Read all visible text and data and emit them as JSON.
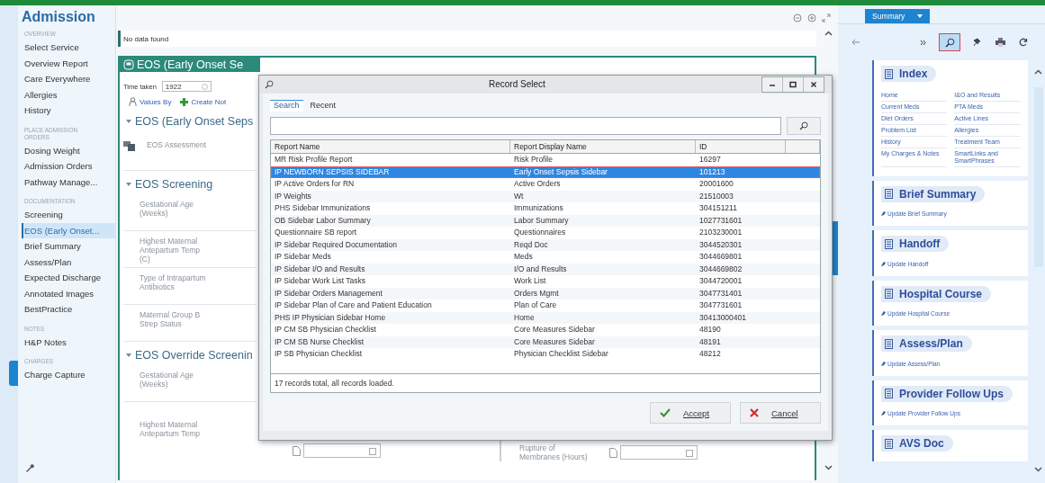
{
  "app": {
    "title": "Admission",
    "message": "No data found"
  },
  "sidebar": {
    "groups": [
      {
        "heading": "OVERVIEW",
        "items": [
          {
            "label": "Select Service",
            "selected": false
          },
          {
            "label": "Overview Report",
            "selected": false
          },
          {
            "label": "Care Everywhere",
            "selected": false
          },
          {
            "label": "Allergies",
            "selected": false
          },
          {
            "label": "History",
            "selected": false
          }
        ]
      },
      {
        "heading": "PLACE ADMISSION ORDERS",
        "items": [
          {
            "label": "Dosing Weight",
            "selected": false
          },
          {
            "label": "Admission Orders",
            "selected": false
          },
          {
            "label": "Pathway Manage...",
            "selected": false
          }
        ]
      },
      {
        "heading": "DOCUMENTATION",
        "items": [
          {
            "label": "Screening",
            "selected": false
          },
          {
            "label": "EOS (Early Onset...",
            "selected": true
          },
          {
            "label": "Brief Summary",
            "selected": false
          },
          {
            "label": "Assess/Plan",
            "selected": false
          },
          {
            "label": "Expected Discharge",
            "selected": false
          },
          {
            "label": "Annotated Images",
            "selected": false
          },
          {
            "label": "BestPractice",
            "selected": false
          }
        ]
      },
      {
        "heading": "NOTES",
        "items": [
          {
            "label": "H&P Notes",
            "selected": false
          }
        ]
      },
      {
        "heading": "CHARGES",
        "items": [
          {
            "label": "Charge Capture",
            "selected": false
          }
        ]
      }
    ]
  },
  "form": {
    "title": "EOS (Early Onset Se",
    "time_label": "Time taken",
    "time_value": "1922",
    "actions": [
      {
        "kind": "person",
        "label": "Values By"
      },
      {
        "kind": "plus",
        "label": "Create Not"
      }
    ],
    "sections": [
      {
        "title": "EOS (Early Onset Seps",
        "expanded": true,
        "rows": [
          {
            "kind": "assessment",
            "label": "EOS Assessment"
          }
        ]
      },
      {
        "title": "EOS Screening",
        "expanded": true,
        "rows": [
          {
            "kind": "text",
            "label": "Gestational Age (Weeks)"
          },
          {
            "kind": "text",
            "label": "Highest Maternal Antepartum Temp (C)"
          },
          {
            "kind": "text",
            "label": "Type of Intrapartum Antibiotics"
          },
          {
            "kind": "text",
            "label": "Maternal Group B Strep Status"
          }
        ]
      },
      {
        "title": "EOS Override Screenin",
        "expanded": true,
        "rows": [
          {
            "kind": "text",
            "label": "Gestational Age (Weeks)"
          },
          {
            "kind": "fields",
            "label": "Highest Maternal Antepartum Temp",
            "label_2": "Rupture of Membranes (Hours)"
          }
        ]
      }
    ]
  },
  "dialog": {
    "title": "Record Select",
    "tabs": [
      {
        "label": "Search",
        "selected": true
      },
      {
        "label": "Recent",
        "selected": false
      }
    ],
    "columns": [
      "Report Name",
      "Report Display Name",
      "ID"
    ],
    "rows": [
      {
        "name": "MR Risk Profile Report",
        "display": "Risk Profile",
        "id": "16297",
        "selected": false
      },
      {
        "name": "IP NEWBORN SEPSIS SIDEBAR",
        "display": "Early Onset Sepsis Sidebar",
        "id": "101213",
        "selected": true
      },
      {
        "name": "IP Active Orders for RN",
        "display": "Active Orders",
        "id": "20001600",
        "selected": false
      },
      {
        "name": "IP Weights",
        "display": "Wt",
        "id": "21510003",
        "selected": false
      },
      {
        "name": "PHS Sidebar Immunizations",
        "display": "Immunizations",
        "id": "304151211",
        "selected": false
      },
      {
        "name": "OB Sidebar Labor Summary",
        "display": "Labor Summary",
        "id": "1027731601",
        "selected": false
      },
      {
        "name": "Questionnaire SB report",
        "display": "Questionnaires",
        "id": "2103230001",
        "selected": false
      },
      {
        "name": "IP Sidebar Required Documentation",
        "display": "Reqd Doc",
        "id": "3044520301",
        "selected": false
      },
      {
        "name": "IP Sidebar Meds",
        "display": "Meds",
        "id": "3044669801",
        "selected": false
      },
      {
        "name": "IP Sidebar I/O and Results",
        "display": "I/O and Results",
        "id": "3044669802",
        "selected": false
      },
      {
        "name": "IP Sidebar Work List Tasks",
        "display": "Work List",
        "id": "3044720001",
        "selected": false
      },
      {
        "name": "IP Sidebar Orders Management",
        "display": "Orders Mgmt",
        "id": "3047731401",
        "selected": false
      },
      {
        "name": "IP Sidebar Plan of Care and Patient Education",
        "display": "Plan of Care",
        "id": "3047731601",
        "selected": false
      },
      {
        "name": "PHS IP Physician Sidebar Home",
        "display": "Home",
        "id": "30413000401",
        "selected": false
      },
      {
        "name": "IP CM SB Physician Checklist",
        "display": "Core Measures Sidebar",
        "id": "48190",
        "selected": false
      },
      {
        "name": "IP CM SB Nurse Checklist",
        "display": "Core Measures Sidebar",
        "id": "48191",
        "selected": false
      },
      {
        "name": "IP SB Physician Checklist",
        "display": "Physician Checklist Sidebar",
        "id": "48212",
        "selected": false
      }
    ],
    "footer": "17 records total, all records loaded.",
    "buttons": [
      {
        "kind": "accept",
        "label": "Accept"
      },
      {
        "kind": "cancel",
        "label": "Cancel"
      }
    ]
  },
  "summary": {
    "tab": "Summary",
    "tools": [
      {
        "kind": "back",
        "selected": false
      },
      {
        "kind": "expand",
        "selected": false
      },
      {
        "kind": "search",
        "selected": true
      },
      {
        "kind": "pin",
        "selected": false
      },
      {
        "kind": "print",
        "selected": false
      },
      {
        "kind": "refresh",
        "selected": false
      }
    ],
    "index": {
      "title": "Index",
      "links": [
        "Home",
        "I&O and Results",
        "Current Meds",
        "PTA Meds",
        "Diet Orders",
        "Active Lines",
        "Problem List",
        "Allergies",
        "History",
        "Treatment Team",
        "My Charges & Notes",
        "SmartLinks and SmartPhrases"
      ]
    },
    "cards": [
      {
        "title": "Brief Summary",
        "link": "Update Brief Summary"
      },
      {
        "title": "Handoff",
        "link": "Update Handoff"
      },
      {
        "title": "Hospital Course",
        "link": "Update Hospital Course"
      },
      {
        "title": "Assess/Plan",
        "link": "Update Assess/Plan"
      },
      {
        "title": "Provider Follow Ups",
        "link": "Update Provider Follow Ups"
      },
      {
        "title": "AVS Doc"
      }
    ]
  }
}
